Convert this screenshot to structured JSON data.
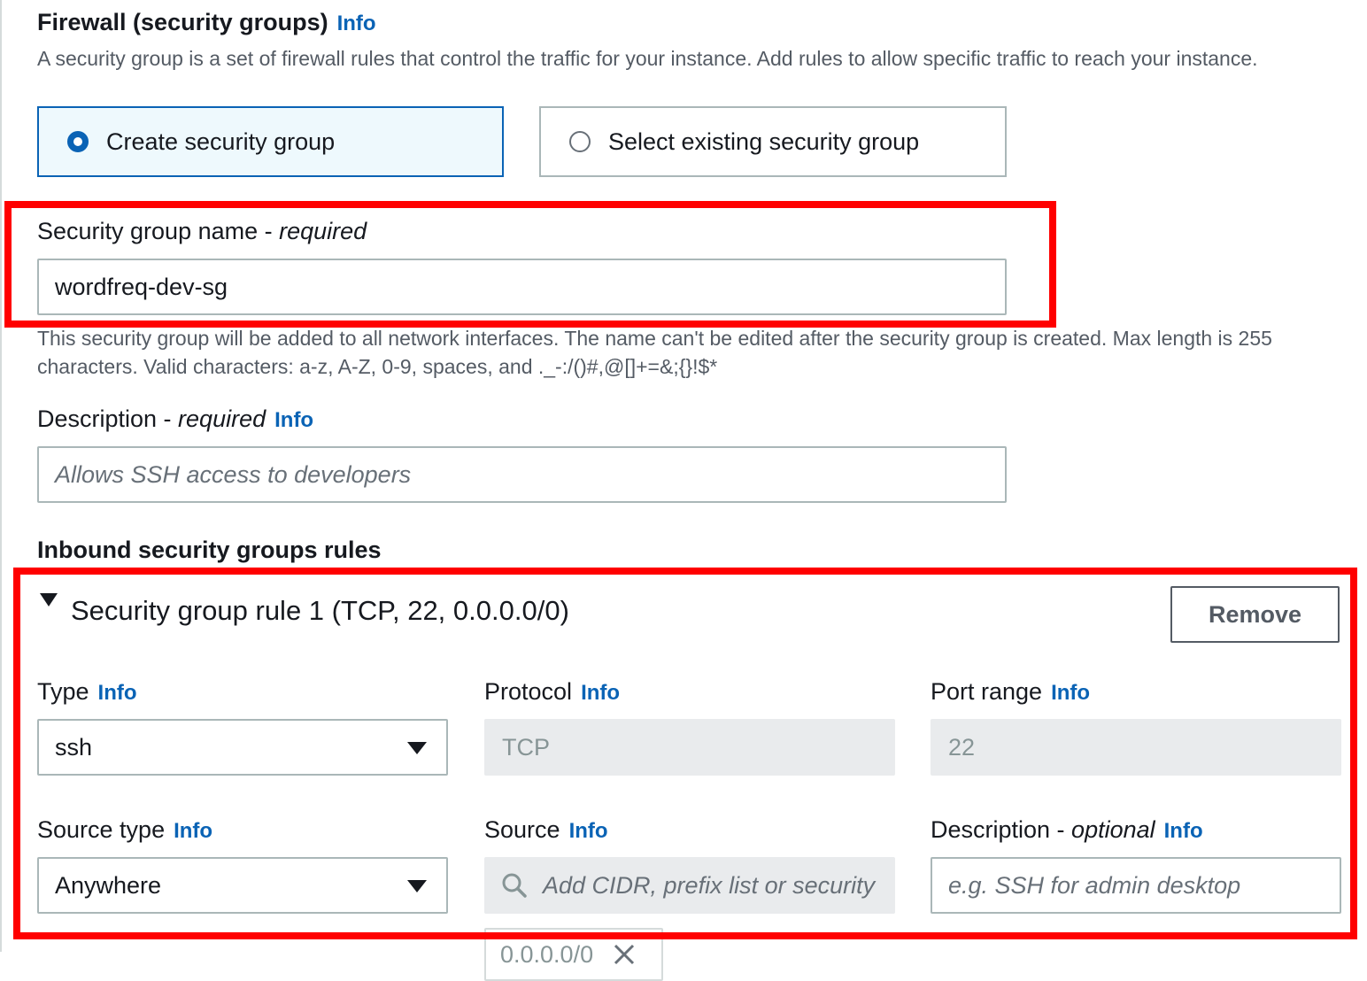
{
  "firewall": {
    "title": "Firewall (security groups)",
    "info": "Info",
    "description": "A security group is a set of firewall rules that control the traffic for your instance. Add rules to allow specific traffic to reach your instance.",
    "options": [
      {
        "label": "Create security group",
        "selected": true
      },
      {
        "label": "Select existing security group",
        "selected": false
      }
    ]
  },
  "sg_name": {
    "label": "Security group name - ",
    "required": "required",
    "value": "wordfreq-dev-sg",
    "hint": "This security group will be added to all network interfaces. The name can't be edited after the security group is created. Max length is 255 characters. Valid characters: a-z, A-Z, 0-9, spaces, and ._-:/()#,@[]+=&;{}!$*"
  },
  "sg_description": {
    "label": "Description - ",
    "required": "required",
    "info": "Info",
    "placeholder": "Allows SSH access to developers"
  },
  "inbound": {
    "title": "Inbound security groups rules",
    "rule_title": "Security group rule 1 (TCP, 22, 0.0.0.0/0)",
    "remove_label": "Remove",
    "type": {
      "label": "Type",
      "info": "Info",
      "value": "ssh"
    },
    "protocol": {
      "label": "Protocol",
      "info": "Info",
      "value": "TCP"
    },
    "port_range": {
      "label": "Port range",
      "info": "Info",
      "value": "22"
    },
    "source_type": {
      "label": "Source type",
      "info": "Info",
      "value": "Anywhere"
    },
    "source": {
      "label": "Source",
      "info": "Info",
      "placeholder": "Add CIDR, prefix list or security",
      "token": "0.0.0.0/0"
    },
    "rule_description": {
      "label": "Description - ",
      "optional": "optional",
      "info": "Info",
      "placeholder": "e.g. SSH for admin desktop"
    }
  },
  "colors": {
    "accent": "#0a63b5",
    "highlight": "#ff0000"
  }
}
